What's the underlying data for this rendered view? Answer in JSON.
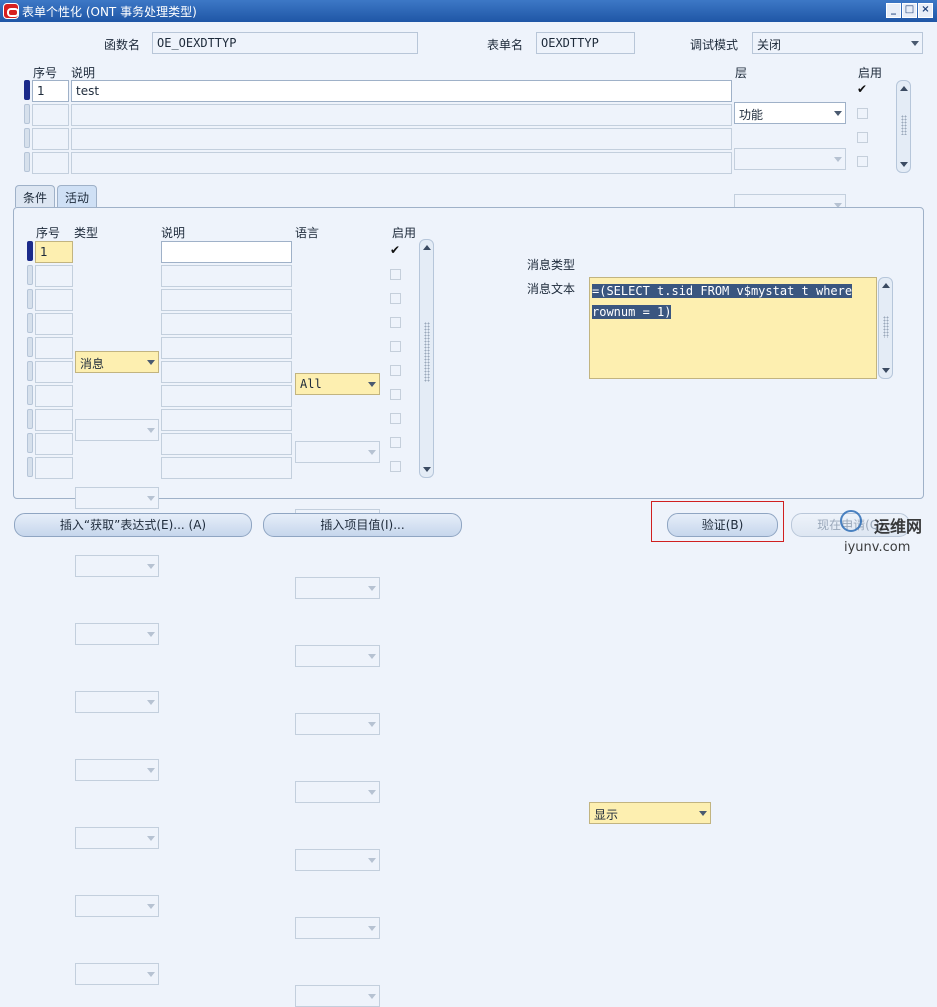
{
  "window": {
    "title": "表单个性化 (ONT 事务处理类型)",
    "minimize": "_",
    "maximize": "□",
    "close": "×"
  },
  "header": {
    "function_label": "函数名",
    "function_value": "OE_OEXDTTYP",
    "form_label": "表单名",
    "form_value": "OEXDTTYP",
    "debug_label": "调试模式",
    "debug_value": "关闭"
  },
  "rules_table": {
    "col_seq": "序号",
    "col_desc": "说明",
    "col_level": "层",
    "col_enabled": "启用",
    "rows": [
      {
        "seq": "1",
        "desc": "test",
        "level": "功能",
        "enabled": "✔"
      }
    ]
  },
  "tabs": [
    "条件",
    "活动"
  ],
  "actions_table": {
    "col_seq": "序号",
    "col_type": "类型",
    "col_desc": "说明",
    "col_lang": "语言",
    "col_enabled": "启用",
    "rows": [
      {
        "seq": "1",
        "type": "消息",
        "desc": "",
        "lang": "All",
        "enabled": "✔"
      }
    ]
  },
  "message": {
    "type_label": "消息类型",
    "type_value": "显示",
    "text_label": "消息文本",
    "text_line1": "=(SELECT t.sid FROM v$mystat t where",
    "text_line2": "rownum = 1)"
  },
  "buttons": {
    "insert_get": "插入“获取”表达式(E)... (A)",
    "insert_item": "插入项目值(I)...",
    "validate": "验证(B)",
    "apply_now": "现在申请(Q)"
  },
  "watermark": {
    "text": "运维网",
    "url": "iyunv.com"
  },
  "colors": {
    "titlebar": "#1f56a6",
    "highlight_yellow": "#fdefb0",
    "validate_outline": "#d02020"
  }
}
